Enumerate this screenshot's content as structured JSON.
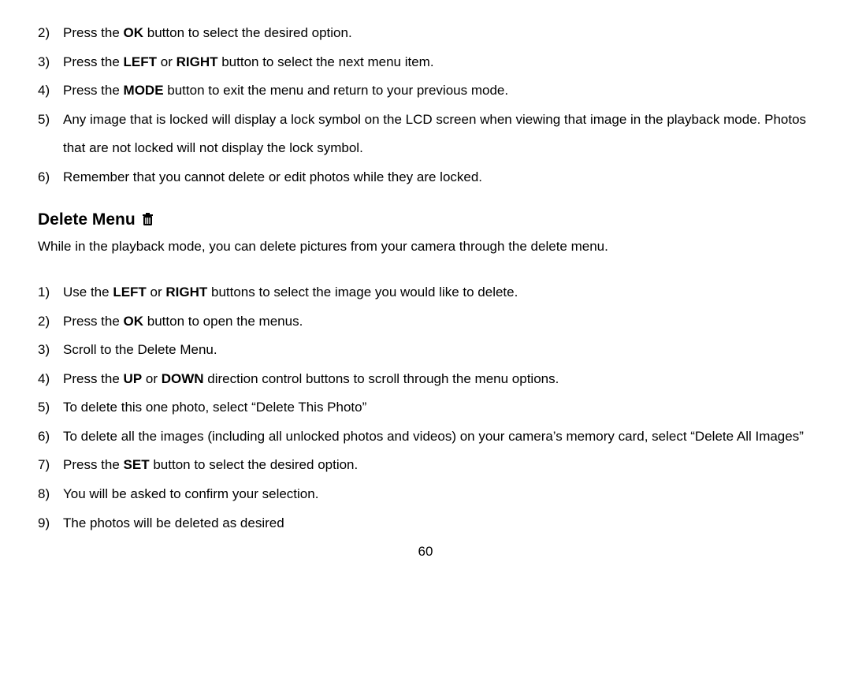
{
  "list1": {
    "items": [
      {
        "num": "2)",
        "segs": [
          {
            "t": "Press the "
          },
          {
            "t": "OK",
            "b": true
          },
          {
            "t": " button to select the desired option."
          }
        ]
      },
      {
        "num": "3)",
        "segs": [
          {
            "t": "Press the "
          },
          {
            "t": "LEFT",
            "b": true
          },
          {
            "t": " or "
          },
          {
            "t": "RIGHT",
            "b": true
          },
          {
            "t": " button to select the next menu item."
          }
        ]
      },
      {
        "num": "4)",
        "segs": [
          {
            "t": "Press the "
          },
          {
            "t": "MODE",
            "b": true
          },
          {
            "t": " button to exit the menu and return to your previous mode."
          }
        ]
      },
      {
        "num": "5)",
        "segs": [
          {
            "t": "Any image that is locked will display a lock symbol on the LCD screen when viewing that image in the playback mode. Photos that are not locked will not display the lock symbol."
          }
        ]
      },
      {
        "num": "6)",
        "segs": [
          {
            "t": "Remember that you cannot delete or edit photos while they are locked."
          }
        ]
      }
    ]
  },
  "section": {
    "heading": "Delete Menu",
    "intro": "While in the playback mode, you can delete pictures from your camera through the delete menu."
  },
  "list2": {
    "items": [
      {
        "num": "1)",
        "segs": [
          {
            "t": "Use the "
          },
          {
            "t": "LEFT",
            "b": true
          },
          {
            "t": " or "
          },
          {
            "t": "RIGHT",
            "b": true
          },
          {
            "t": " buttons to select the image you would like to delete."
          }
        ]
      },
      {
        "num": "2)",
        "segs": [
          {
            "t": "Press the "
          },
          {
            "t": "OK",
            "b": true
          },
          {
            "t": " button to open the menus."
          }
        ]
      },
      {
        "num": "3)",
        "segs": [
          {
            "t": "Scroll to the Delete Menu."
          }
        ]
      },
      {
        "num": "4)",
        "segs": [
          {
            "t": "Press the "
          },
          {
            "t": "UP",
            "b": true
          },
          {
            "t": " or "
          },
          {
            "t": "DOWN",
            "b": true
          },
          {
            "t": " direction control buttons to scroll through the menu options."
          }
        ]
      },
      {
        "num": "5)",
        "segs": [
          {
            "t": "To delete this one photo, select “Delete This Photo”"
          }
        ]
      },
      {
        "num": "6)",
        "segs": [
          {
            "t": "To delete all the images (including all unlocked photos and videos) on your camera’s memory card, select “Delete All Images”"
          }
        ]
      },
      {
        "num": "7)",
        "segs": [
          {
            "t": "Press the "
          },
          {
            "t": "SET",
            "b": true
          },
          {
            "t": " button to select the desired option."
          }
        ]
      },
      {
        "num": "8)",
        "segs": [
          {
            "t": "You will be asked to confirm your selection."
          }
        ]
      },
      {
        "num": "9)",
        "segs": [
          {
            "t": "The photos will be deleted as desired"
          }
        ]
      }
    ]
  },
  "page_number": "60"
}
